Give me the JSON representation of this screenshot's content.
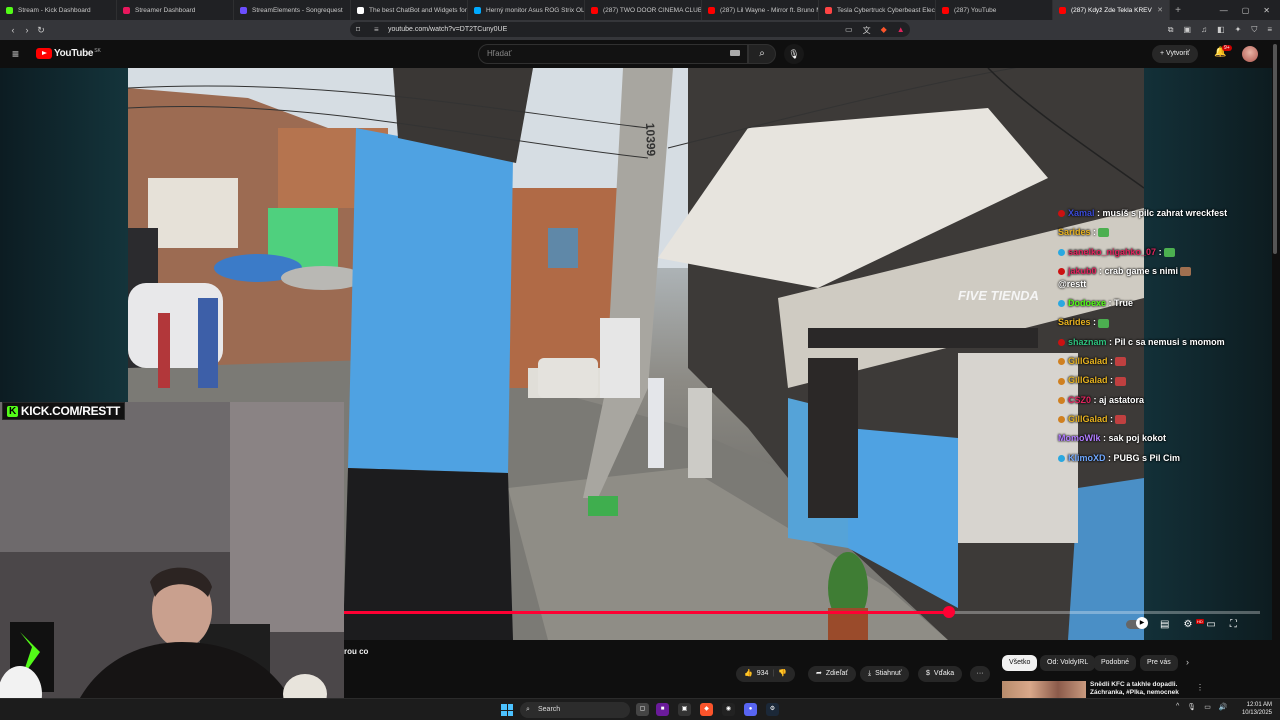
{
  "browser": {
    "tabs": [
      {
        "label": "Stream - Kick Dashboard",
        "color": "#53fc18"
      },
      {
        "label": "Streamer Dashboard",
        "color": "#e8175d"
      },
      {
        "label": "StreamElements - Songrequest",
        "color": "#6b4eff"
      },
      {
        "label": "The best ChatBot and Widgets for",
        "color": "#ffffff"
      },
      {
        "label": "Herný monitor Asus ROG Strix OLE",
        "color": "#00aaff"
      },
      {
        "label": "(287) TWO DOOR CINEMA CLUB |",
        "color": "#ff0000"
      },
      {
        "label": "(287) Lil Wayne - Mirror ft. Bruno M",
        "color": "#ff0000"
      },
      {
        "label": "Tesla Cybertruck Cyberbeast Electr",
        "color": "#ff4444"
      },
      {
        "label": "(287) YouTube",
        "color": "#ff0000"
      },
      {
        "label": "(287) Když Zde Tekla KREV",
        "color": "#ff0000",
        "active": true
      }
    ],
    "url": "youtube.com/watch?v=DT2TCuny0UE"
  },
  "youtube": {
    "logo_text": "YouTube",
    "country_code": "SK",
    "search_placeholder": "Hľadať",
    "create_label": "Vytvoriť",
    "notifications_badge": "9+"
  },
  "stream_overlay": {
    "kick_banner": "KICK.COM/RESTT",
    "chat": [
      {
        "user": "Xamal",
        "user_color": "#3a4bd8",
        "text": ": musíš s pilc zahrat wreckfest",
        "badge": "#cc1111"
      },
      {
        "user": "Sarides",
        "user_color": "#e8b320",
        "text": ":",
        "emote": "#4caf50"
      },
      {
        "user": "sanelko_nigahko_07",
        "user_color": "#e0245e",
        "text": ":",
        "badge": "#2aa8e0",
        "emote": "#4caf50"
      },
      {
        "user": "jakub0",
        "user_color": "#e0245e",
        "text": ": crab game s nimi",
        "badge": "#cc1111",
        "emote": "#a07050",
        "text2": "@restt"
      },
      {
        "user": "Dodoexe",
        "user_color": "#53fc18",
        "text": ": True",
        "badge": "#2aa8e0"
      },
      {
        "user": "Sarides",
        "user_color": "#e8b320",
        "text": ":",
        "emote": "#4caf50"
      },
      {
        "user": "shaznam",
        "user_color": "#2ec27e",
        "text": ": Pil c sa nemusi s momom",
        "badge": "#cc1111"
      },
      {
        "user": "GillGalad",
        "user_color": "#e8b320",
        "text": ":",
        "badge": "#d08020",
        "emote": "#c04040"
      },
      {
        "user": "GillGalad",
        "user_color": "#e8b320",
        "text": ":",
        "badge": "#d08020",
        "emote": "#c04040"
      },
      {
        "user": "CSZ0",
        "user_color": "#e0245e",
        "text": ": aj astatora",
        "badge": "#d08020"
      },
      {
        "user": "GillGalad",
        "user_color": "#e8b320",
        "text": ":",
        "badge": "#d08020",
        "emote": "#c04040"
      },
      {
        "user": "MomoWlk",
        "user_color": "#b07cff",
        "text": ": sak poj kokot"
      },
      {
        "user": "KlimoXD",
        "user_color": "#6fa8ff",
        "text": ": PUBG s Pil Cim",
        "badge": "#2aa8e0"
      }
    ],
    "shop_sign": "FIVE TIENDA",
    "pole_number": "10399"
  },
  "player": {
    "progress": 0.66
  },
  "video_info": {
    "title": "rou co",
    "likes": "934",
    "share_label": "Zdieľať",
    "download_label": "Stiahnuť",
    "thanks_label": "Vďaka",
    "more": "···"
  },
  "recommendations": {
    "chips": [
      {
        "label": "Všetko",
        "active": true
      },
      {
        "label": "Od: VoldyIRL"
      },
      {
        "label": "Podobné"
      },
      {
        "label": "Pre vás"
      }
    ],
    "first_title": "Snědli KFC a takhle dopadli. Záchranka, #Plka, nemocnek"
  },
  "taskbar": {
    "search_label": "Search",
    "time": "12:01 AM",
    "date": "10/13/2025"
  }
}
